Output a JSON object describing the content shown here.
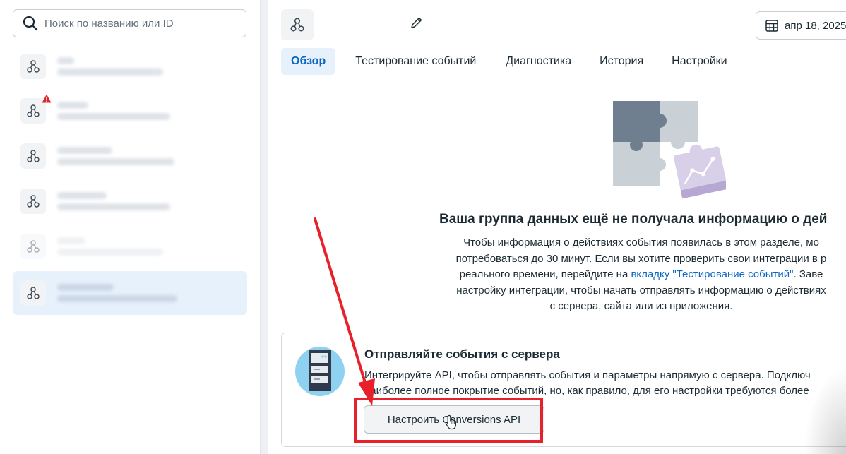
{
  "sidebar": {
    "search": {
      "placeholder": "Поиск по названию или ID",
      "value": ""
    },
    "items": [
      {
        "selected": false,
        "muted": false,
        "warning": false
      },
      {
        "selected": false,
        "muted": false,
        "warning": true
      },
      {
        "selected": false,
        "muted": false,
        "warning": false
      },
      {
        "selected": false,
        "muted": false,
        "warning": false
      },
      {
        "selected": false,
        "muted": true,
        "warning": false
      },
      {
        "selected": true,
        "muted": false,
        "warning": false
      }
    ]
  },
  "header": {
    "date_range": "апр 18, 2025"
  },
  "tabs": [
    {
      "label": "Обзор",
      "active": true
    },
    {
      "label": "Тестирование событий",
      "active": false
    },
    {
      "label": "Диагностика",
      "active": false
    },
    {
      "label": "История",
      "active": false
    },
    {
      "label": "Настройки",
      "active": false
    }
  ],
  "empty_state": {
    "title": "Ваша группа данных ещё не получала информацию о дей",
    "line1": "Чтобы информация о действиях события появилась в этом разделе, мо",
    "line2": "потребоваться до 30 минут. Если вы хотите проверить свои интеграции в р",
    "line3_prefix": "реального времени, перейдите на ",
    "line3_link": "вкладку \"Тестирование событий\"",
    "line3_suffix": ". Заве",
    "line4": "настройку интеграции, чтобы начать отправлять информацию о действиях",
    "line5": "с сервера, сайта или из приложения."
  },
  "server_card": {
    "title": "Отправляйте события с сервера",
    "line1": "Интегрируйте API, чтобы отправлять события и параметры напрямую с сервера. Подключ",
    "line2": "наиболее полное покрытие событий, но, как правило, для его настройки требуются более",
    "button_label": "Настроить Conversions API"
  },
  "icons": {
    "search": "search-icon",
    "dataset": "dataset-icon",
    "warning": "warning-icon",
    "edit": "pencil-icon",
    "calendar": "calendar-icon",
    "puzzle": "puzzle-illustration",
    "server": "server-illustration",
    "cursor": "hand-cursor-icon"
  },
  "colors": {
    "accent": "#0a66c2",
    "selected_bg": "#e7f1fc",
    "warning": "#e0242c",
    "annotation": "#e8202a"
  }
}
